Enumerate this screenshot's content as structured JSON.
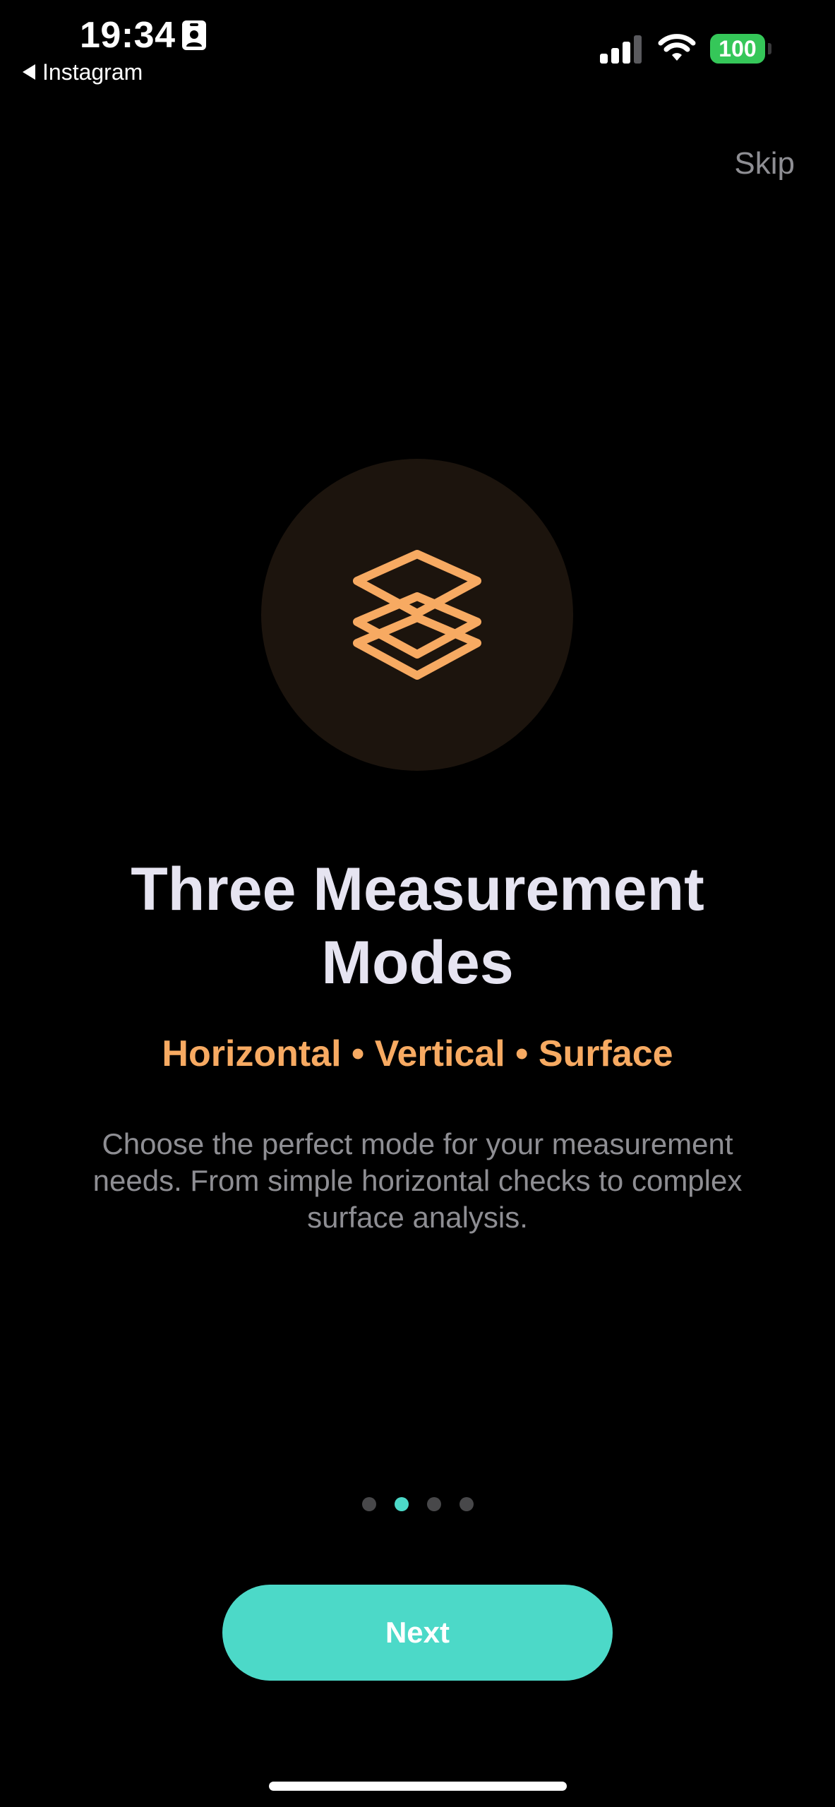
{
  "status_bar": {
    "time": "19:34",
    "back_app": "Instagram",
    "battery": "100",
    "icons": [
      "id-card-icon",
      "cellular-signal-icon",
      "wifi-icon",
      "battery-icon"
    ],
    "battery_color": "#35c759"
  },
  "header": {
    "skip_label": "Skip"
  },
  "hero": {
    "icon": "layers-icon",
    "icon_color": "#f7aa62",
    "circle_color": "#1c140d"
  },
  "content": {
    "title": "Three Measurement Modes",
    "subtitle": "Horizontal • Vertical • Surface",
    "description": "Choose the perfect mode for your measurement needs. From simple horizontal checks to complex surface analysis."
  },
  "pagination": {
    "total": 4,
    "current": 2,
    "active_color": "#4cd9c8"
  },
  "footer": {
    "next_label": "Next",
    "accent_color": "#4cd9c8"
  }
}
